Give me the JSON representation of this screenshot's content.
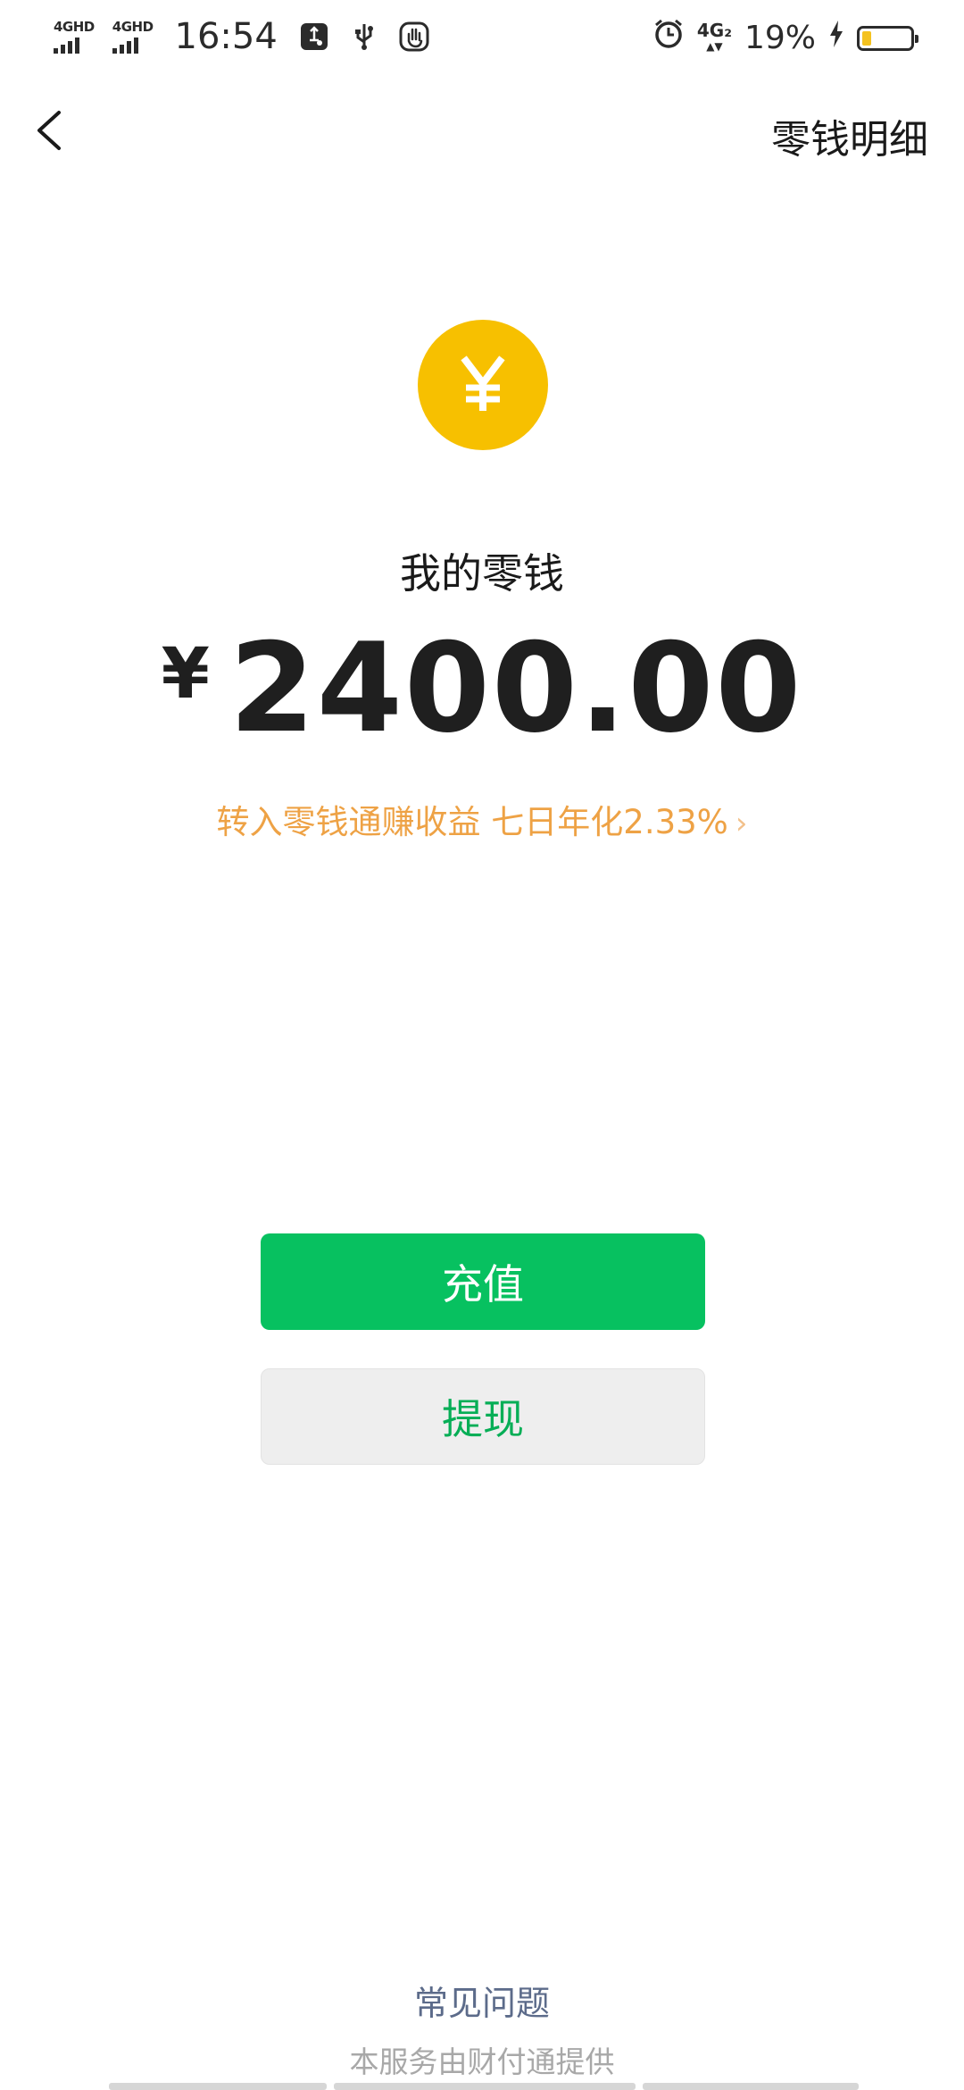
{
  "status_bar": {
    "signal_1_label": "4GHD",
    "signal_2_label": "4GHD",
    "time": "16:54",
    "network_label": "4G₂",
    "battery_percent_text": "19%",
    "battery_level": 0.19,
    "icons": [
      "usb-settings-icon",
      "usb-icon",
      "hand-icon",
      "alarm-icon",
      "charging-icon"
    ]
  },
  "nav": {
    "back_icon": "chevron-left-icon",
    "detail_link": "零钱明细"
  },
  "wallet": {
    "coin_icon": "yen-icon",
    "coin_color": "#f7c000",
    "title": "我的零钱",
    "currency_symbol": "¥",
    "amount": "2400.00",
    "promo_text": "转入零钱通赚收益 七日年化2.33%",
    "promo_color": "#eea245"
  },
  "actions": {
    "recharge_label": "充值",
    "withdraw_label": "提现",
    "accent_color": "#07c160"
  },
  "footer": {
    "faq_label": "常见问题",
    "provider_text": "本服务由财付通提供"
  }
}
